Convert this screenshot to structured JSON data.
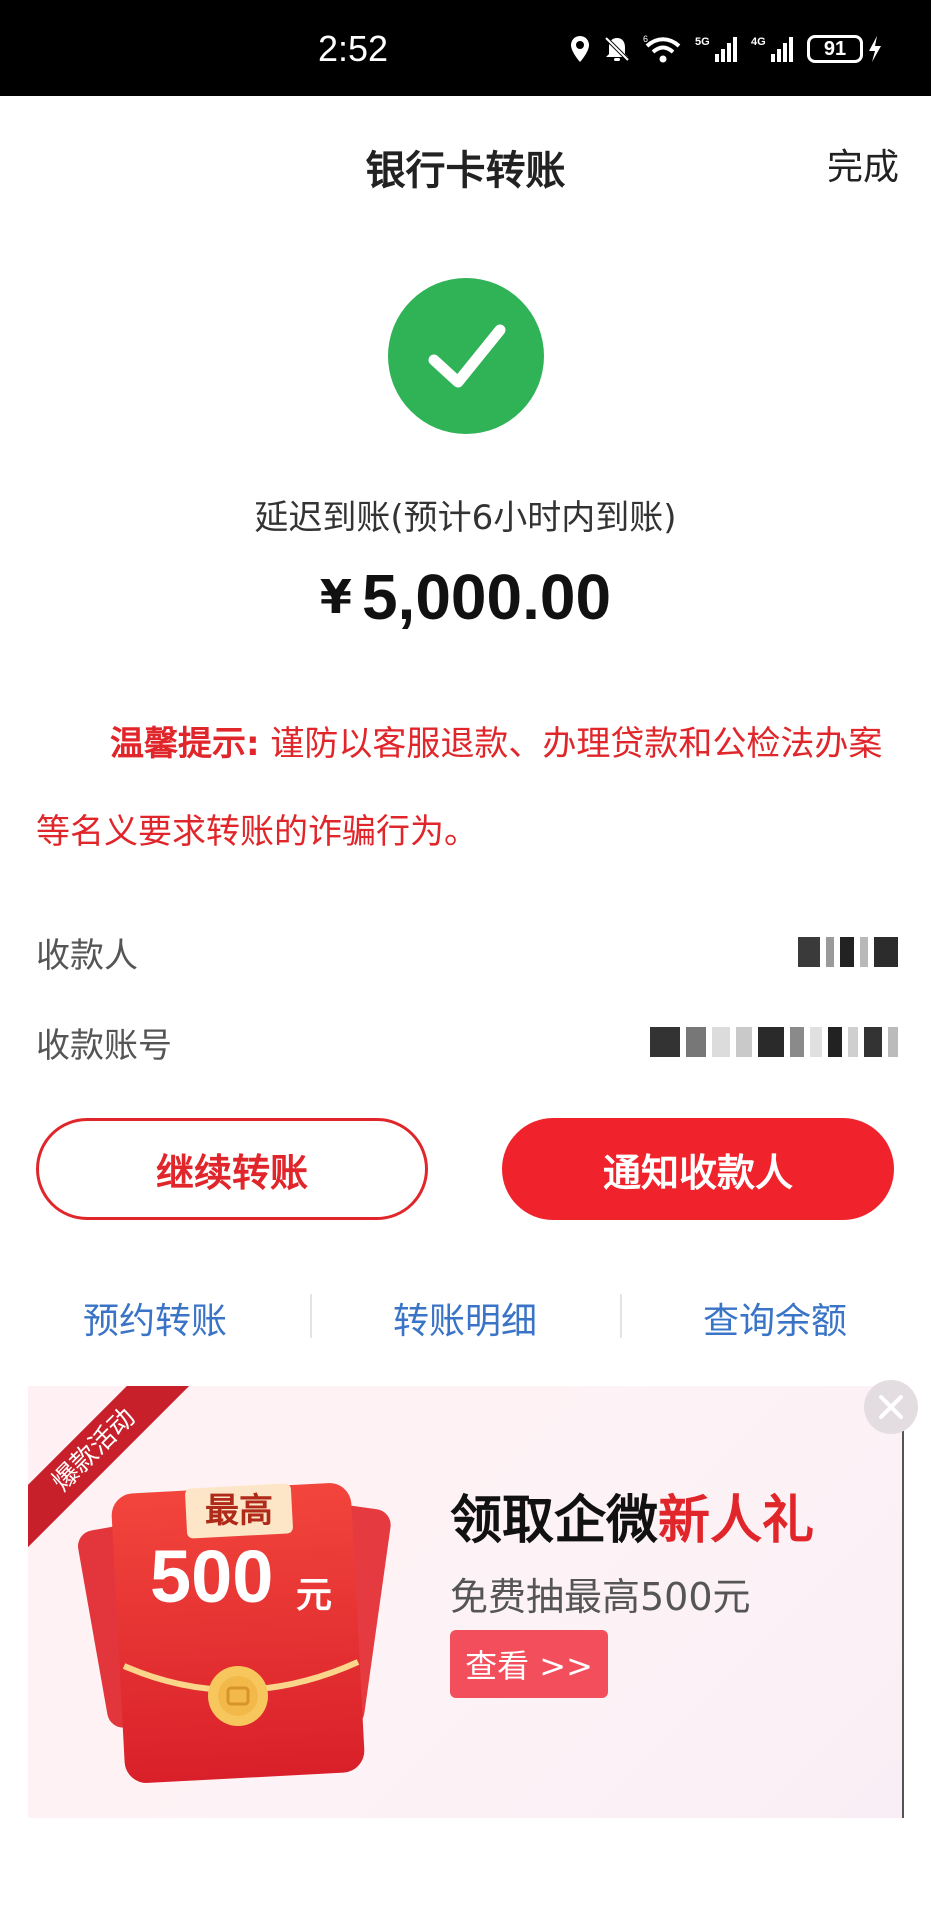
{
  "status_bar": {
    "time": "2:52",
    "battery": "91",
    "signal_labels": [
      "5G",
      "4G"
    ]
  },
  "header": {
    "title": "银行卡转账",
    "done_label": "完成"
  },
  "result": {
    "status_text": "延迟到账(预计6小时内到账)",
    "currency": "¥",
    "amount": "5,000.00",
    "success_color": "#2fb356"
  },
  "warning": {
    "label": "温馨提示:",
    "text": " 谨防以客服退款、办理贷款和公检法办案等名义要求转账的诈骗行为。",
    "color": "#e0262a"
  },
  "info": {
    "payee_label": "收款人",
    "account_label": "收款账号",
    "payee_value_state": "pixelated",
    "account_value_state": "pixelated"
  },
  "actions": {
    "continue_label": "继续转账",
    "notify_label": "通知收款人"
  },
  "links": [
    {
      "label": "预约转账"
    },
    {
      "label": "转账明细"
    },
    {
      "label": "查询余额"
    }
  ],
  "banner": {
    "ribbon": "爆款活动",
    "envelope_top": "最高",
    "envelope_amount": "500",
    "envelope_unit": "元",
    "title_main": "领取企微",
    "title_highlight": "新人礼",
    "subtitle": "免费抽最高500元",
    "button_label": "查看 >>",
    "close_icon": "close-icon"
  },
  "icons": {
    "location": "location-icon",
    "bell": "bell-off-icon",
    "wifi": "wifi-icon",
    "signal": "signal-icon",
    "battery": "battery-icon",
    "charging": "bolt-icon",
    "success": "check-icon"
  }
}
